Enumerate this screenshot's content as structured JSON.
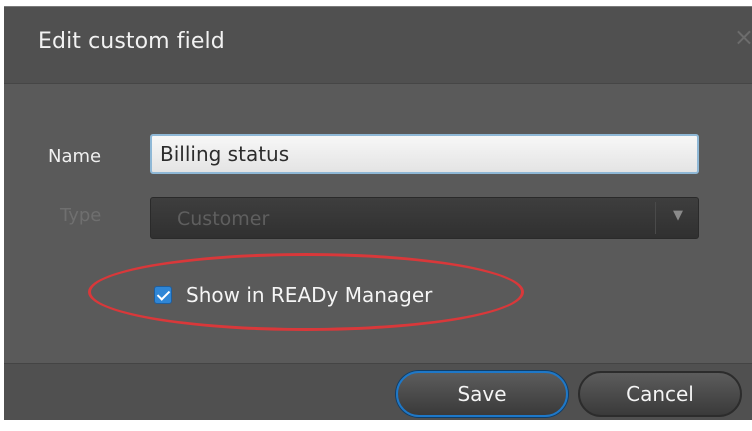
{
  "dialog": {
    "title": "Edit custom field",
    "close_icon": "close-icon"
  },
  "form": {
    "name_label": "Name",
    "name_value": "Billing status",
    "type_label": "Type",
    "type_value": "Customer",
    "type_arrow_icon": "chevron-down-icon",
    "show_checkbox_checked": true,
    "show_checkbox_label": "Show in READy Manager"
  },
  "footer": {
    "save_label": "Save",
    "cancel_label": "Cancel"
  },
  "colors": {
    "dialog_bg": "#5a5a5a",
    "highlight": "#d9383a",
    "accent": "#2f86d6"
  }
}
